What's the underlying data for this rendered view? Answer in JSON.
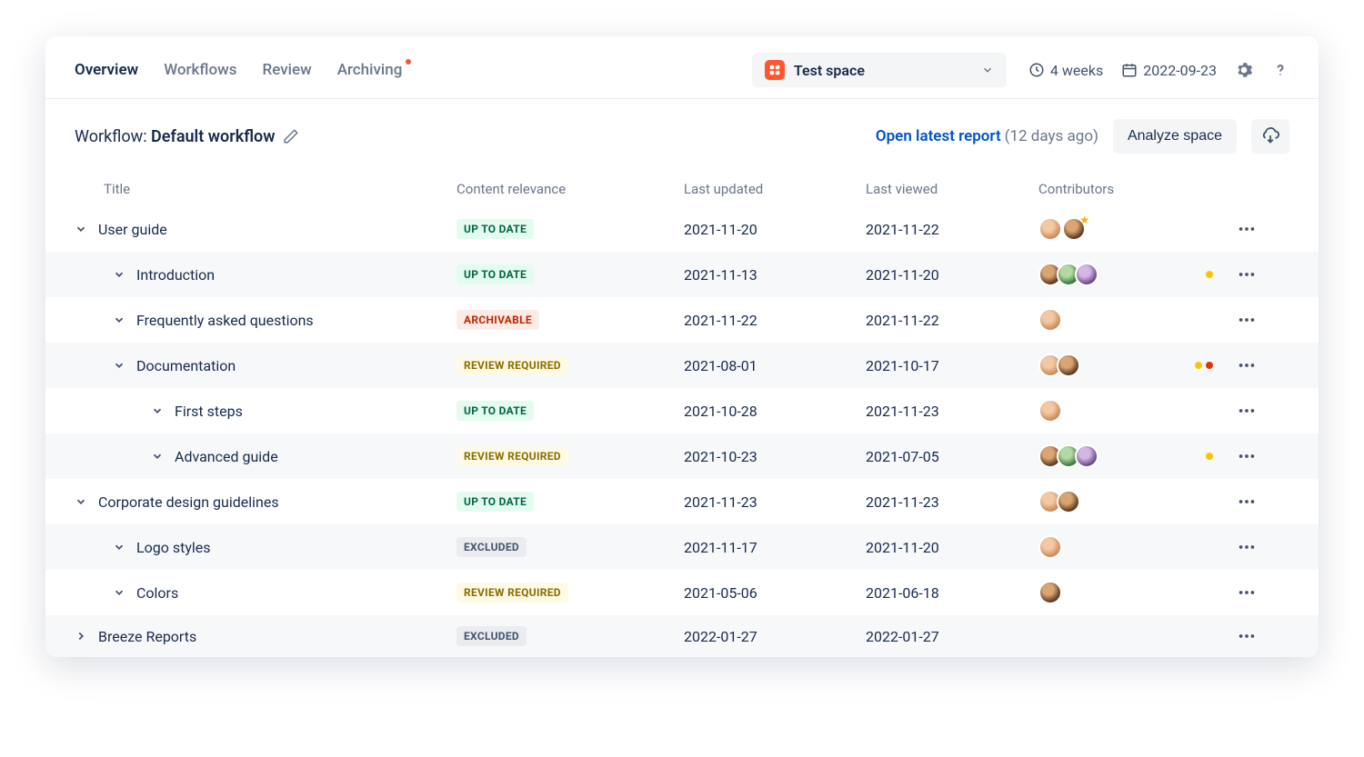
{
  "tabs": [
    {
      "label": "Overview",
      "active": true
    },
    {
      "label": "Workflows",
      "active": false
    },
    {
      "label": "Review",
      "active": false
    },
    {
      "label": "Archiving",
      "active": false,
      "notif": true
    }
  ],
  "space": {
    "name": "Test space"
  },
  "meta": {
    "duration": "4 weeks",
    "date": "2022-09-23"
  },
  "workflow": {
    "prefix": "Workflow:",
    "name": "Default workflow"
  },
  "report": {
    "link": "Open latest report",
    "age": "(12 days ago)"
  },
  "analyze_label": "Analyze space",
  "columns": {
    "title": "Title",
    "relevance": "Content relevance",
    "updated": "Last updated",
    "viewed": "Last viewed",
    "contributors": "Contributors"
  },
  "badge_labels": {
    "uptodate": "UP TO DATE",
    "archivable": "ARCHIVABLE",
    "review": "REVIEW REQUIRED",
    "excluded": "EXCLUDED"
  },
  "rows": [
    {
      "title": "User guide",
      "indent": 0,
      "expanded": true,
      "relevance": "uptodate",
      "updated": "2021-11-20",
      "viewed": "2021-11-22",
      "avatars": [
        "av1",
        "av2"
      ],
      "star": true,
      "flags": [],
      "alt": false
    },
    {
      "title": "Introduction",
      "indent": 1,
      "expanded": true,
      "relevance": "uptodate",
      "updated": "2021-11-13",
      "viewed": "2021-11-20",
      "avatars": [
        "av2",
        "av3",
        "av4"
      ],
      "flags": [
        "yellow"
      ],
      "alt": true
    },
    {
      "title": "Frequently asked questions",
      "indent": 1,
      "expanded": true,
      "relevance": "archivable",
      "updated": "2021-11-22",
      "viewed": "2021-11-22",
      "avatars": [
        "av1"
      ],
      "flags": [],
      "alt": false
    },
    {
      "title": "Documentation",
      "indent": 1,
      "expanded": true,
      "relevance": "review",
      "updated": "2021-08-01",
      "viewed": "2021-10-17",
      "avatars": [
        "av1",
        "av2"
      ],
      "flags": [
        "yellow",
        "red"
      ],
      "alt": true
    },
    {
      "title": "First steps",
      "indent": 2,
      "expanded": true,
      "relevance": "uptodate",
      "updated": "2021-10-28",
      "viewed": "2021-11-23",
      "avatars": [
        "av1"
      ],
      "flags": [],
      "alt": false
    },
    {
      "title": "Advanced guide",
      "indent": 2,
      "expanded": true,
      "relevance": "review",
      "updated": "2021-10-23",
      "viewed": "2021-07-05",
      "avatars": [
        "av2",
        "av3",
        "av4"
      ],
      "flags": [
        "yellow"
      ],
      "alt": true
    },
    {
      "title": "Corporate design guidelines",
      "indent": 0,
      "expanded": true,
      "relevance": "uptodate",
      "updated": "2021-11-23",
      "viewed": "2021-11-23",
      "avatars": [
        "av1",
        "av2"
      ],
      "flags": [],
      "alt": false
    },
    {
      "title": "Logo styles",
      "indent": 1,
      "expanded": true,
      "relevance": "excluded",
      "updated": "2021-11-17",
      "viewed": "2021-11-20",
      "avatars": [
        "av1"
      ],
      "flags": [],
      "alt": true
    },
    {
      "title": "Colors",
      "indent": 1,
      "expanded": true,
      "relevance": "review",
      "updated": "2021-05-06",
      "viewed": "2021-06-18",
      "avatars": [
        "av2"
      ],
      "flags": [],
      "alt": false
    },
    {
      "title": "Breeze Reports",
      "indent": 0,
      "expanded": false,
      "relevance": "excluded",
      "updated": "2022-01-27",
      "viewed": "2022-01-27",
      "avatars": [],
      "flags": [],
      "alt": true
    }
  ]
}
